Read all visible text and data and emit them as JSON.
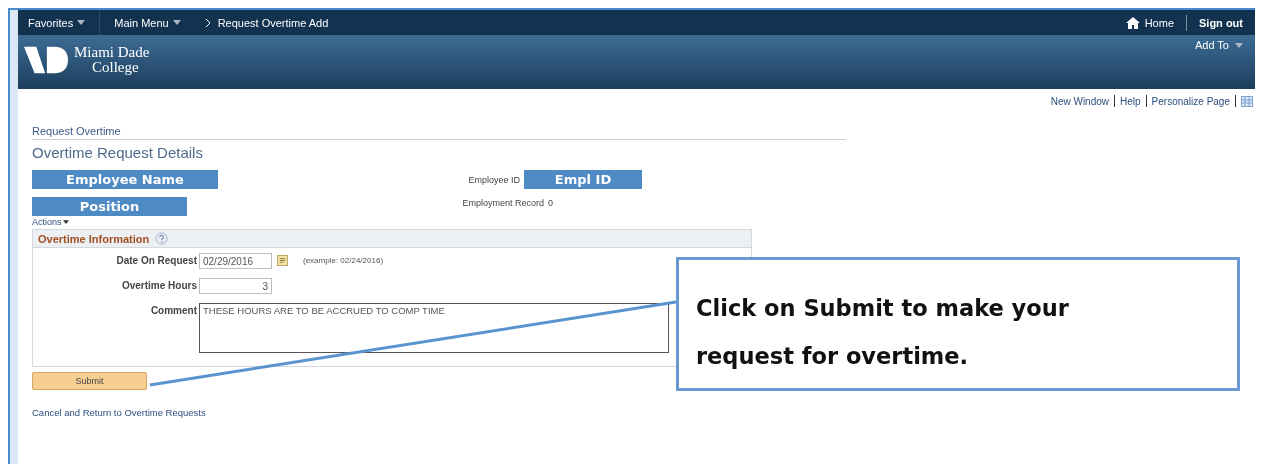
{
  "nav": {
    "favorites": "Favorites",
    "main_menu": "Main Menu",
    "breadcrumb": "Request Overtime Add",
    "home": "Home",
    "sign_out": "Sign out",
    "add_to": "Add To"
  },
  "logo": {
    "line1": "Miami Dade",
    "line2": "College"
  },
  "page_links": [
    "New Window",
    "Help",
    "Personalize Page"
  ],
  "page_title": "Request Overtime",
  "heading": "Overtime Request Details",
  "employee": {
    "name": "Employee Name",
    "position": "Position",
    "id_label": "Employee ID",
    "id_value": "Empl ID",
    "record_label": "Employment Record",
    "record_value": "0"
  },
  "actions": "Actions",
  "section": {
    "title": "Overtime Information",
    "fields": [
      {
        "kind": "date",
        "label": "Date On Request",
        "value": "02/29/2016",
        "hint": "(example: 02/24/2016)"
      },
      {
        "kind": "number",
        "label": "Overtime Hours",
        "value": "3"
      },
      {
        "kind": "textarea",
        "label": "Comment",
        "value": "THESE HOURS ARE TO BE ACCRUED TO COMP TIME"
      }
    ]
  },
  "submit": "Submit",
  "cancel_link": "Cancel and Return to Overtime Requests",
  "callout": "Click on Submit to make your request for overtime."
}
